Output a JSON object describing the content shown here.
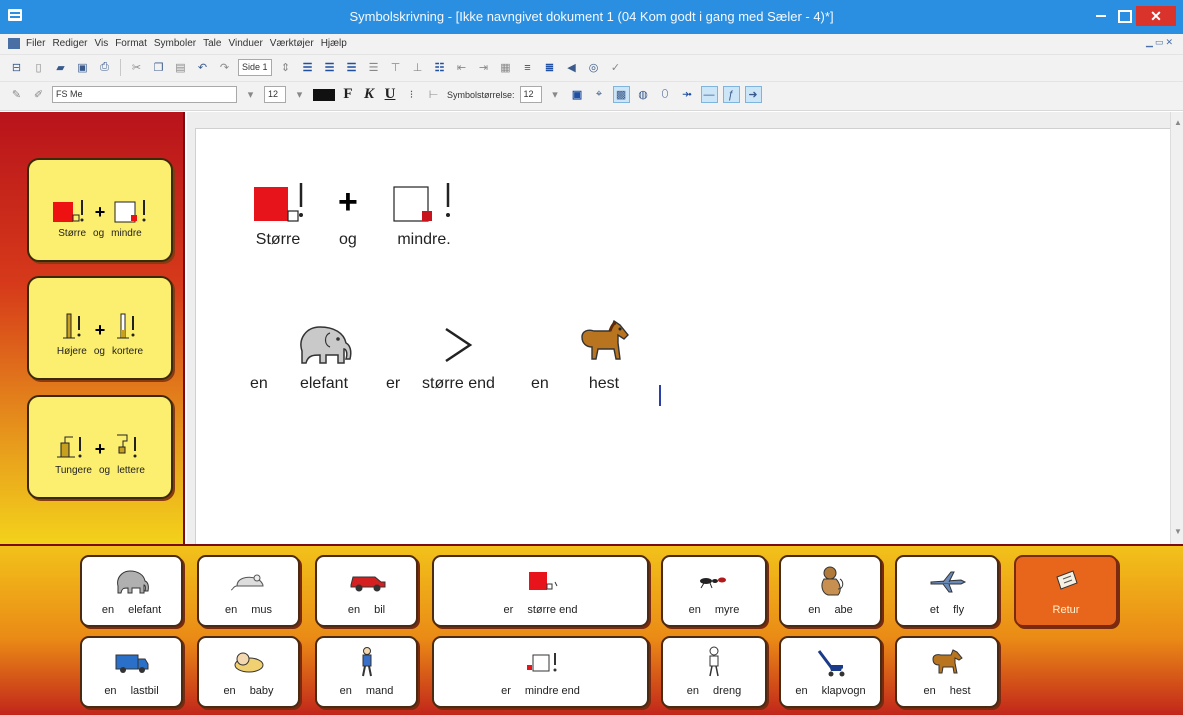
{
  "window": {
    "title": "Symbolskrivning - [Ikke navngivet dokument 1 (04 Kom godt i gang med Sæler - 4)*]"
  },
  "menubar": {
    "items": [
      "Filer",
      "Rediger",
      "Vis",
      "Format",
      "Symboler",
      "Tale",
      "Vinduer",
      "Værktøjer",
      "Hjælp"
    ]
  },
  "toolbar": {
    "page_selector": "Side 1",
    "font_name": "FS Me",
    "font_size": "12",
    "bold": "F",
    "italic": "K",
    "underline": "U",
    "symbol_size_label": "Symbolstørrelse:",
    "symbol_size_value": "12"
  },
  "colors": {
    "titlebar": "#2a8fe0",
    "close_button": "#d9332c",
    "panel_red": "#b8131b",
    "panel_yellow": "#f3d21b",
    "left_button_fill": "#fcee6e",
    "orange_button": "#e8661c",
    "caret": "#2b3fa8"
  },
  "left_panel": {
    "buttons": [
      {
        "icon_a": "big-square-icon",
        "icon_b": "small-square-icon",
        "plus": "+",
        "word1": "Større",
        "word2": "og",
        "word3": "mindre"
      },
      {
        "icon_a": "tall-bar-icon",
        "icon_b": "short-bar-icon",
        "plus": "+",
        "word1": "Højere",
        "word2": "og",
        "word3": "kortere"
      },
      {
        "icon_a": "long-object-icon",
        "icon_b": "light-object-icon",
        "plus": "+",
        "word1": "Tungere",
        "word2": "og",
        "word3": "lettere"
      }
    ]
  },
  "document": {
    "line1": [
      {
        "icon": "big-square-icon",
        "text": "Større"
      },
      {
        "icon": "plus-icon",
        "text": "og"
      },
      {
        "icon": "small-square-icon",
        "text": "mindre."
      }
    ],
    "line2": [
      {
        "icon": "",
        "text": "en"
      },
      {
        "icon": "elephant-icon",
        "text": "elefant"
      },
      {
        "icon": "",
        "text": "er"
      },
      {
        "icon": "greater-than-icon",
        "text": "større end"
      },
      {
        "icon": "",
        "text": "en"
      },
      {
        "icon": "horse-icon",
        "text": "hest"
      }
    ]
  },
  "grid": {
    "row1": [
      {
        "icon": "elephant-icon",
        "w1": "en",
        "w2": "elefant"
      },
      {
        "icon": "mouse-icon",
        "w1": "en",
        "w2": "mus"
      },
      {
        "icon": "car-icon",
        "w1": "en",
        "w2": "bil"
      },
      {
        "icon": "bigger-than-icon",
        "w1": "er",
        "w2": "større end"
      },
      {
        "icon": "ant-icon",
        "w1": "en",
        "w2": "myre"
      },
      {
        "icon": "monkey-icon",
        "w1": "en",
        "w2": "abe"
      },
      {
        "icon": "airplane-icon",
        "w1": "et",
        "w2": "fly"
      },
      {
        "icon": "return-icon",
        "w1": "Retur",
        "w2": ""
      }
    ],
    "row2": [
      {
        "icon": "truck-icon",
        "w1": "en",
        "w2": "lastbil"
      },
      {
        "icon": "baby-icon",
        "w1": "en",
        "w2": "baby"
      },
      {
        "icon": "man-icon",
        "w1": "en",
        "w2": "mand"
      },
      {
        "icon": "smaller-than-icon",
        "w1": "er",
        "w2": "mindre end"
      },
      {
        "icon": "boy-icon",
        "w1": "en",
        "w2": "dreng"
      },
      {
        "icon": "stroller-icon",
        "w1": "en",
        "w2": "klapvogn"
      },
      {
        "icon": "horse-icon",
        "w1": "en",
        "w2": "hest"
      }
    ]
  }
}
